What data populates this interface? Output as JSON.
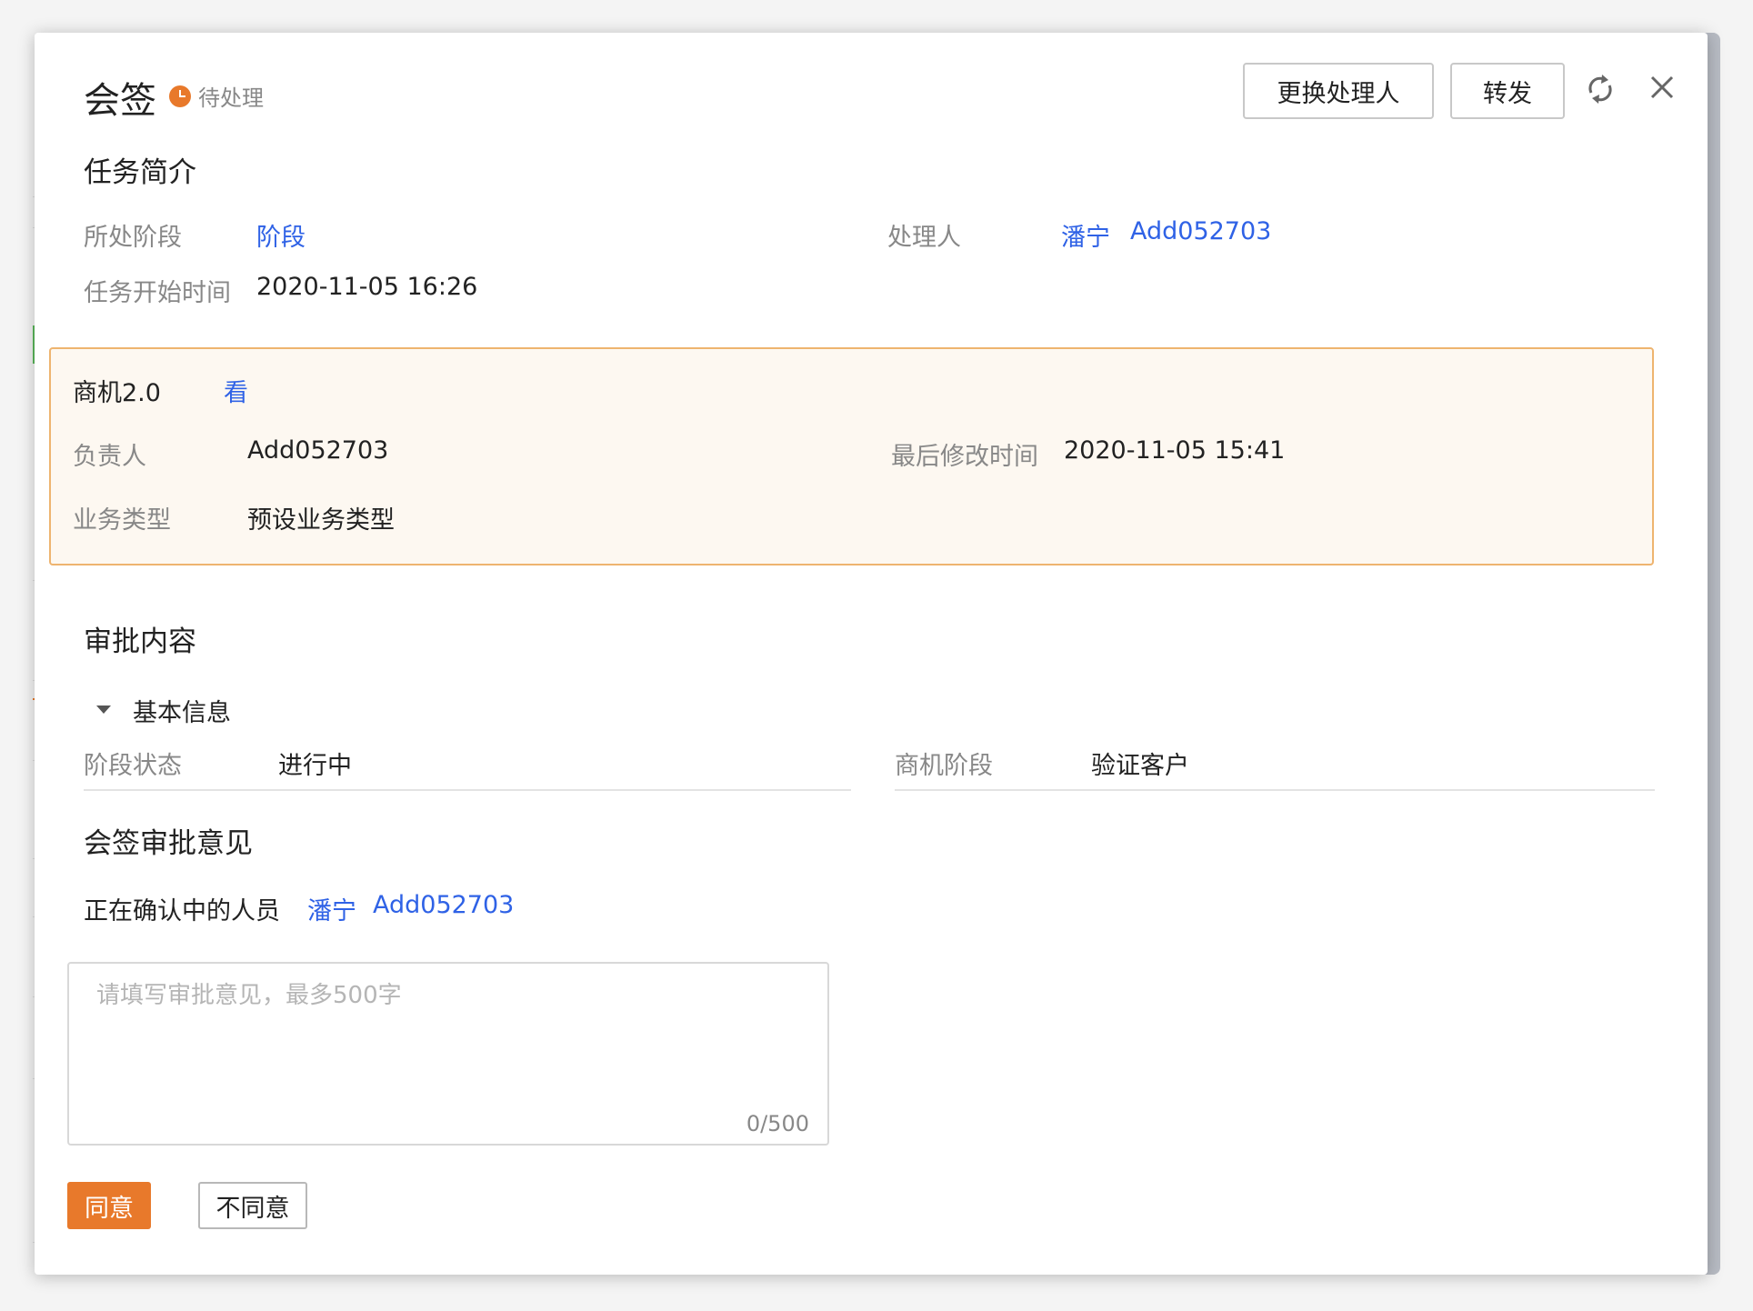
{
  "header": {
    "title": "会签",
    "status": "待处理",
    "change_handler_label": "更换处理人",
    "forward_label": "转发"
  },
  "task_intro": {
    "section_title": "任务简介",
    "stage_label": "所处阶段",
    "stage_value": "阶段",
    "handler_label": "处理人",
    "handler_name": "潘宁",
    "handler_id": "Add052703",
    "start_time_label": "任务开始时间",
    "start_time_value": "2020-11-05 16:26"
  },
  "record_card": {
    "title": "商机2.0",
    "view_link": "看",
    "owner_label": "负责人",
    "owner_value": "Add052703",
    "modified_label": "最后修改时间",
    "modified_value": "2020-11-05 15:41",
    "biz_type_label": "业务类型",
    "biz_type_value": "预设业务类型"
  },
  "approval_content": {
    "section_title": "审批内容",
    "group_title": "基本信息",
    "stage_status_label": "阶段状态",
    "stage_status_value": "进行中",
    "opportunity_stage_label": "商机阶段",
    "opportunity_stage_value": "验证客户"
  },
  "countersign": {
    "section_title": "会签审批意见",
    "confirming_label": "正在确认中的人员",
    "confirming_name": "潘宁",
    "confirming_id": "Add052703",
    "opinion_placeholder": "请填写审批意见，最多500字",
    "opinion_value": "",
    "counter": "0/500",
    "agree_label": "同意",
    "disagree_label": "不同意"
  },
  "colors": {
    "accent": "#e8792b",
    "link": "#2f62e6",
    "card_border": "#eeb46f",
    "card_bg": "#fdf8f1"
  }
}
